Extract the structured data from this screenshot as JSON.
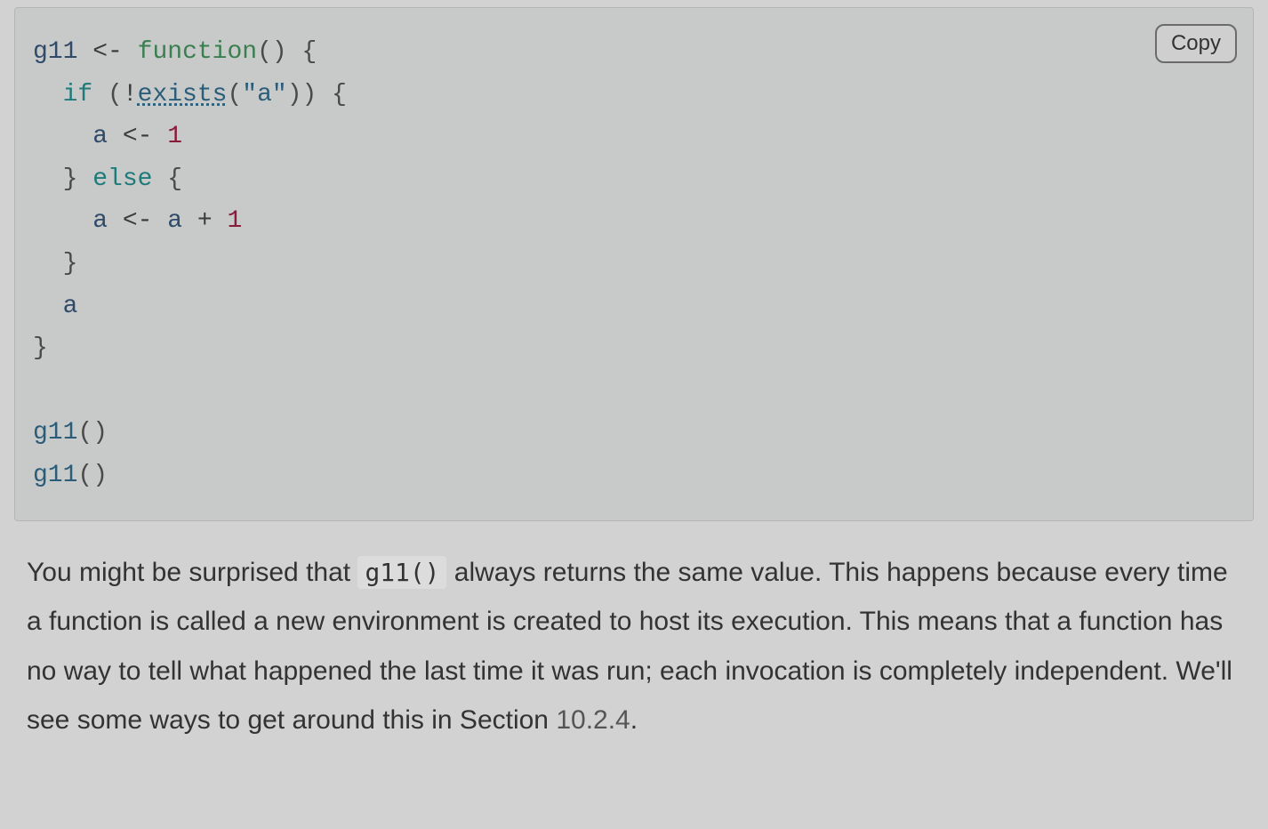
{
  "code_block": {
    "copy_label": "Copy",
    "tokens": {
      "g11": "g11",
      "assign": "<-",
      "function_kw": "function",
      "if_kw": "if",
      "else_kw": "else",
      "exists_fn": "exists",
      "str_a": "\"a\"",
      "a": "a",
      "one": "1",
      "plus": "+",
      "bang": "!",
      "call1": "g11",
      "call2": "g11"
    }
  },
  "paragraph": {
    "pre_inline": "You might be surprised that ",
    "inline_code": "g11()",
    "post_inline": " always returns the same value. This happens because every time a function is called a new environment is created to host its execution. This means that a function has no way to tell what happened the last time it was run; each invocation is completely independent. We'll see some ways to get around this in Section ",
    "section_ref": "10.2.4",
    "period": "."
  }
}
